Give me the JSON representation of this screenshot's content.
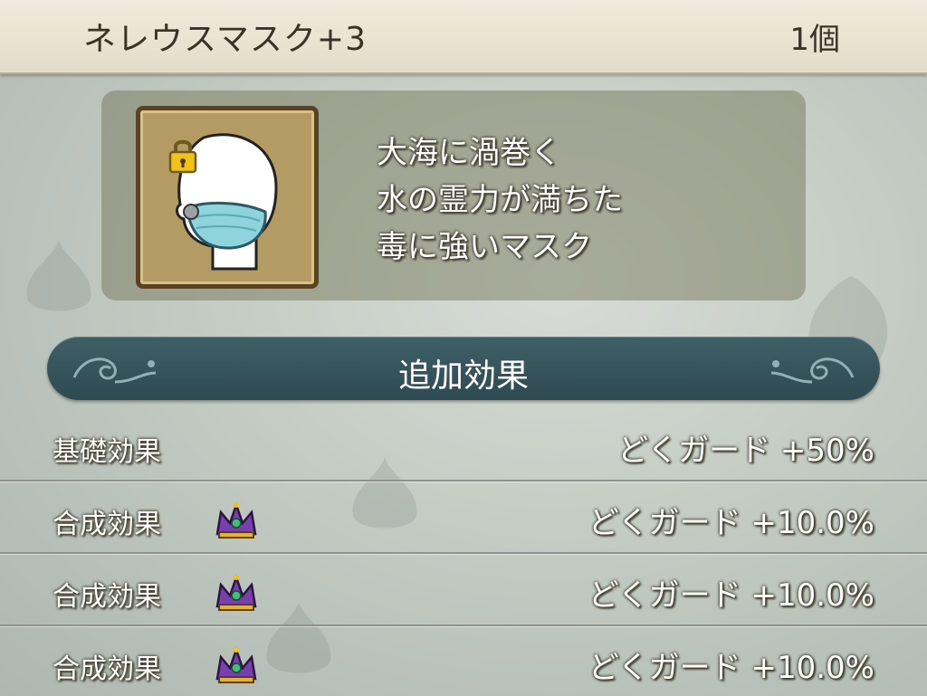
{
  "header": {
    "item_name": "ネレウスマスク+3",
    "count": "1個"
  },
  "item": {
    "icon": "lock-icon",
    "image": "mask-on-mannequin-head",
    "description": [
      "大海に渦巻く",
      "水の霊力が満ちた",
      "毒に強いマスク"
    ]
  },
  "section": {
    "title": "追加効果"
  },
  "effects": [
    {
      "label": "基礎効果",
      "value": "どくガード +50%",
      "icon": null
    },
    {
      "label": "合成効果",
      "value": "どくガード +10.0%",
      "icon": "crown-icon"
    },
    {
      "label": "合成効果",
      "value": "どくガード +10.0%",
      "icon": "crown-icon"
    },
    {
      "label": "合成効果",
      "value": "どくガード +10.0%",
      "icon": "crown-icon"
    }
  ],
  "colors": {
    "header_bg": "#ece6d4",
    "banner_bg": "#355159",
    "icon_frame": "#b39b63"
  }
}
